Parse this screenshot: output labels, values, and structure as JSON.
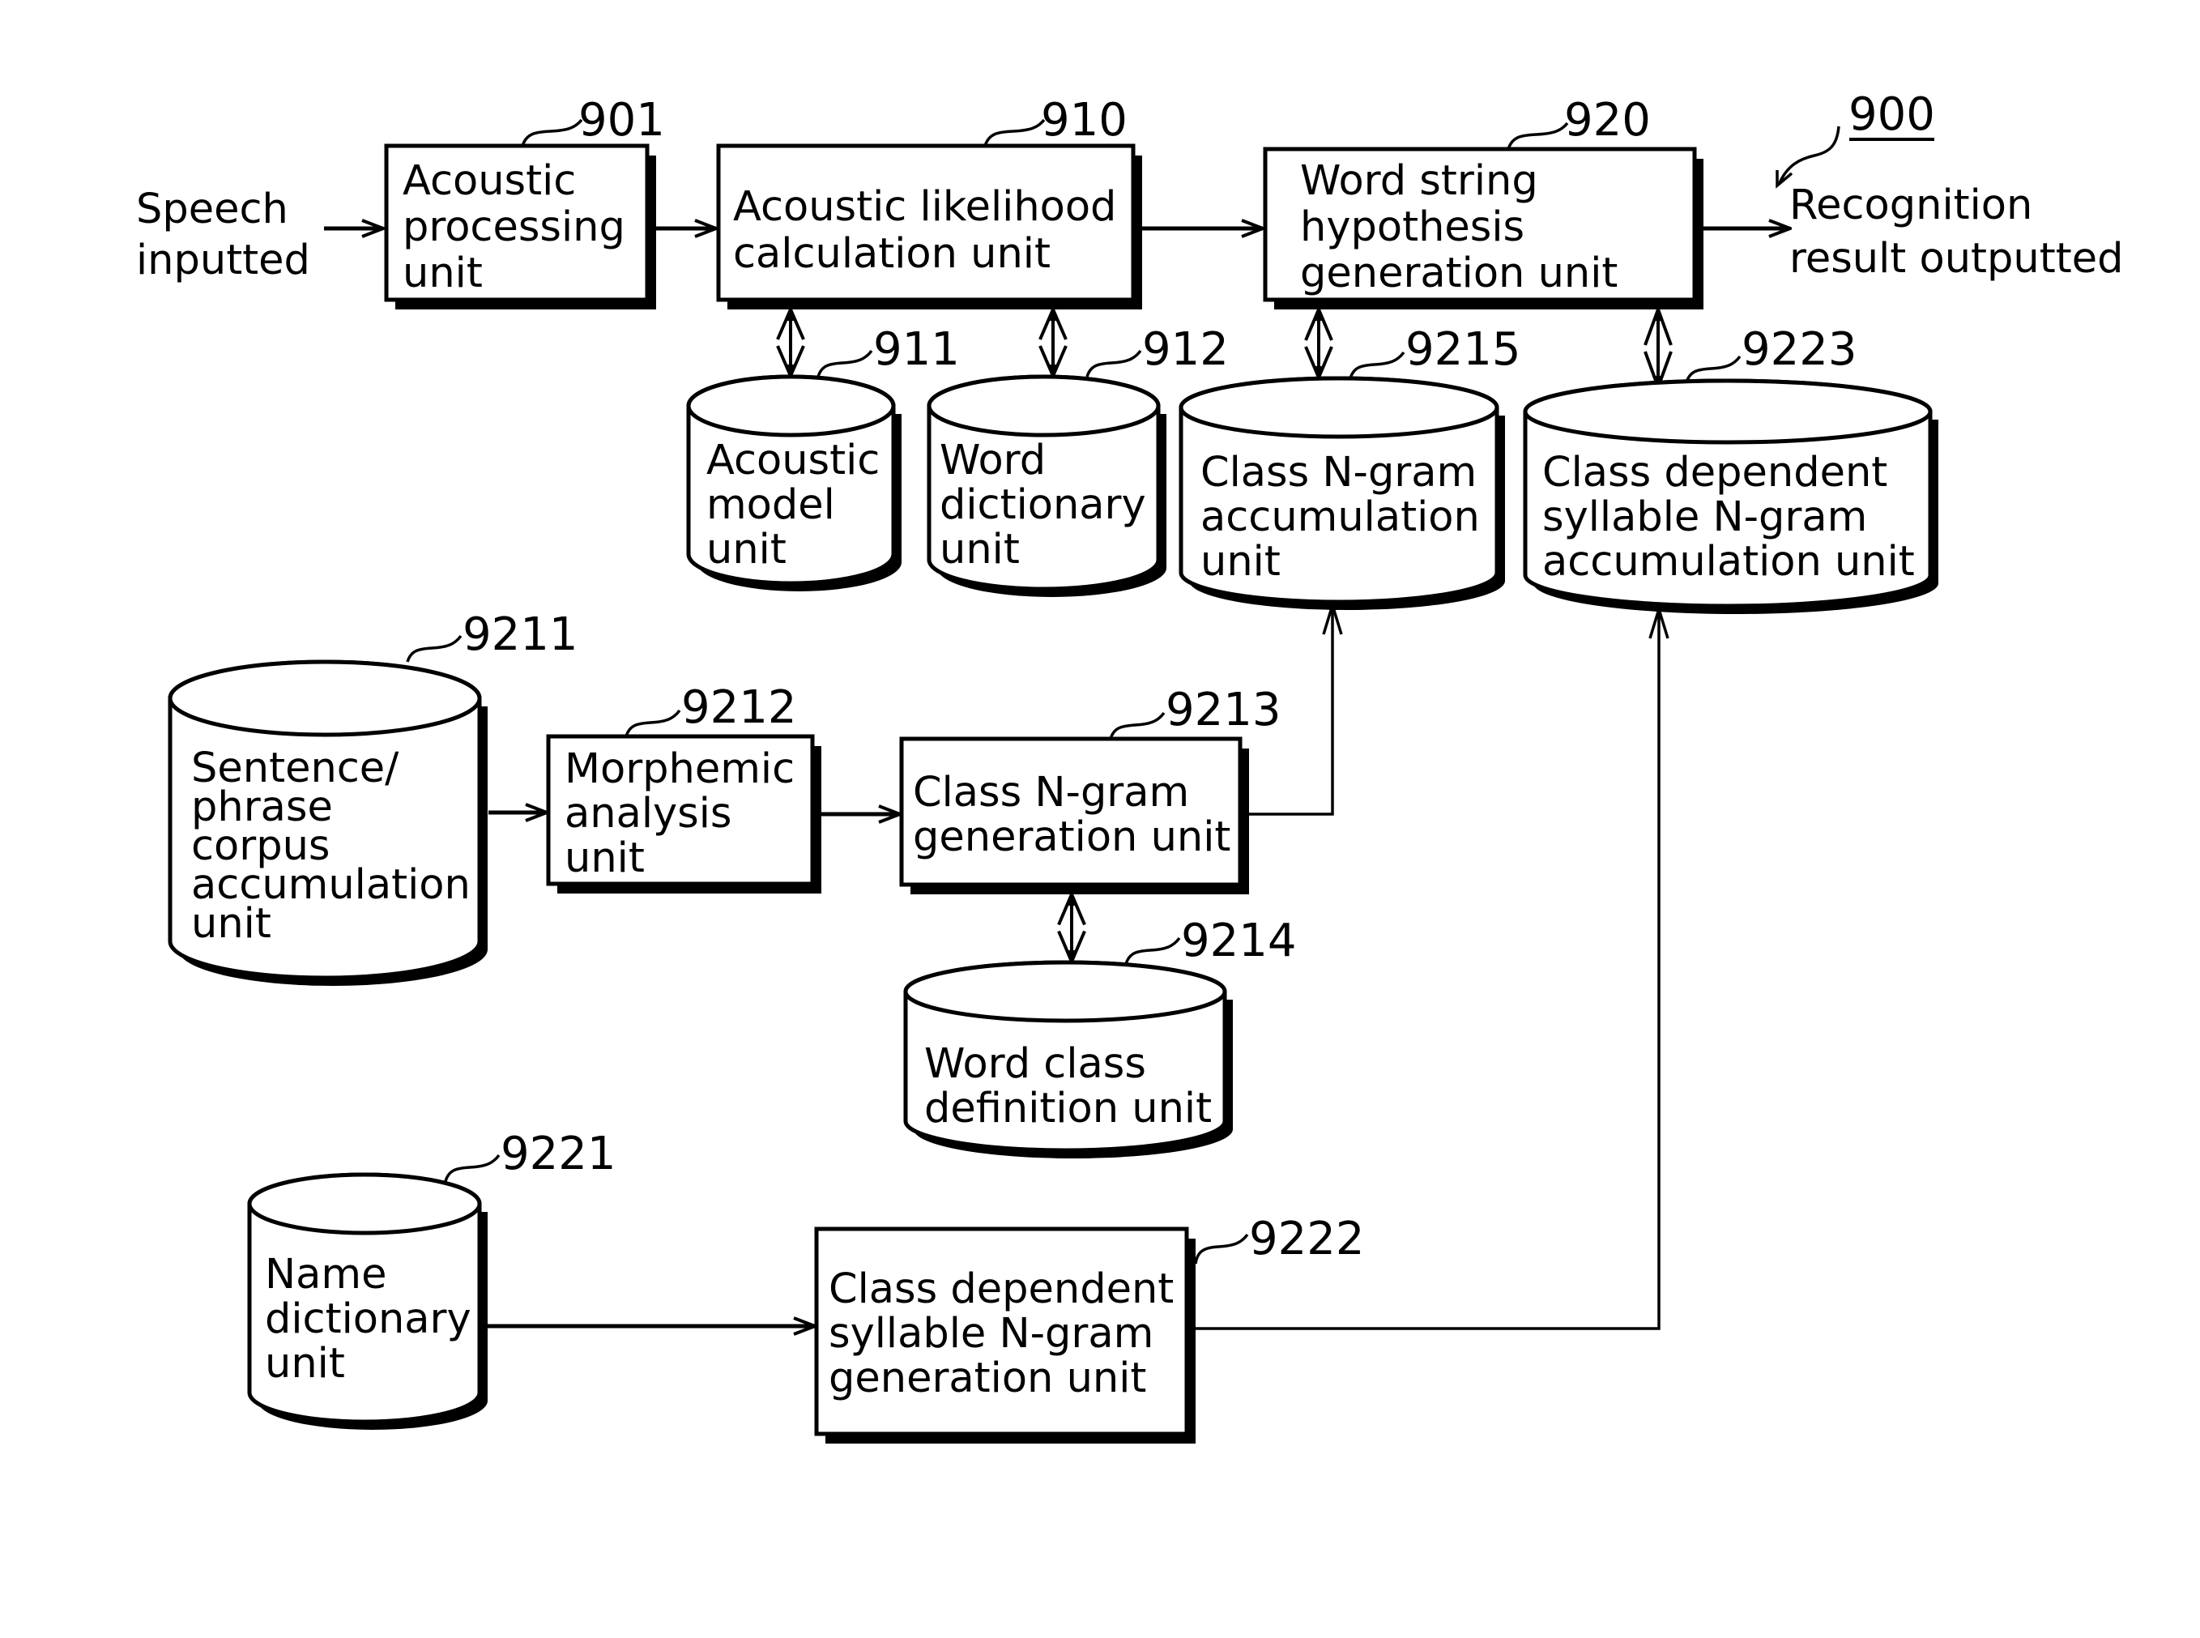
{
  "figure": {
    "reference": "900",
    "input_label": [
      "Speech",
      "inputted"
    ],
    "output_label": [
      "Recognition",
      "result outputted"
    ]
  },
  "boxes": {
    "acoustic_processing": {
      "ref": "901",
      "lines": [
        "Acoustic",
        "processing",
        "unit"
      ]
    },
    "acoustic_likelihood": {
      "ref": "910",
      "lines": [
        "Acoustic likelihood",
        "calculation unit"
      ]
    },
    "word_string_hypothesis": {
      "ref": "920",
      "lines": [
        "Word string",
        "hypothesis",
        "generation unit"
      ]
    },
    "morphemic_analysis": {
      "ref": "9212",
      "lines": [
        "Morphemic",
        "analysis",
        "unit"
      ]
    },
    "class_ngram_generation": {
      "ref": "9213",
      "lines": [
        "Class N-gram",
        "generation unit"
      ]
    },
    "class_dependent_syllable_generation": {
      "ref": "9222",
      "lines": [
        "Class dependent",
        "syllable N-gram",
        "generation unit"
      ]
    }
  },
  "databases": {
    "acoustic_model": {
      "ref": "911",
      "lines": [
        "Acoustic",
        "model",
        "unit"
      ]
    },
    "word_dictionary": {
      "ref": "912",
      "lines": [
        "Word",
        "dictionary",
        "unit"
      ]
    },
    "class_ngram_accumulation": {
      "ref": "9215",
      "lines": [
        "Class N-gram",
        "accumulation",
        "unit"
      ]
    },
    "class_dependent_syllable_accumulation": {
      "ref": "9223",
      "lines": [
        "Class dependent",
        "syllable N-gram",
        "accumulation unit"
      ]
    },
    "sentence_phrase_corpus": {
      "ref": "9211",
      "lines": [
        "Sentence/",
        "phrase",
        "corpus",
        "accumulation",
        "unit"
      ]
    },
    "word_class_definition": {
      "ref": "9214",
      "lines": [
        "Word class",
        "definition unit"
      ]
    },
    "name_dictionary": {
      "ref": "9221",
      "lines": [
        "Name",
        "dictionary",
        "unit"
      ]
    }
  },
  "connections": [
    {
      "from": "input",
      "to": "acoustic_processing",
      "type": "arrow"
    },
    {
      "from": "acoustic_processing",
      "to": "acoustic_likelihood",
      "type": "arrow"
    },
    {
      "from": "acoustic_likelihood",
      "to": "word_string_hypothesis",
      "type": "arrow"
    },
    {
      "from": "word_string_hypothesis",
      "to": "output",
      "type": "arrow"
    },
    {
      "from": "acoustic_likelihood",
      "to": "acoustic_model",
      "type": "bidirectional"
    },
    {
      "from": "acoustic_likelihood",
      "to": "word_dictionary",
      "type": "bidirectional"
    },
    {
      "from": "word_string_hypothesis",
      "to": "class_ngram_accumulation",
      "type": "bidirectional"
    },
    {
      "from": "word_string_hypothesis",
      "to": "class_dependent_syllable_accumulation",
      "type": "bidirectional"
    },
    {
      "from": "sentence_phrase_corpus",
      "to": "morphemic_analysis",
      "type": "arrow"
    },
    {
      "from": "morphemic_analysis",
      "to": "class_ngram_generation",
      "type": "arrow"
    },
    {
      "from": "class_ngram_generation",
      "to": "class_ngram_accumulation",
      "type": "arrow"
    },
    {
      "from": "class_ngram_generation",
      "to": "word_class_definition",
      "type": "bidirectional"
    },
    {
      "from": "name_dictionary",
      "to": "class_dependent_syllable_generation",
      "type": "arrow"
    },
    {
      "from": "class_dependent_syllable_generation",
      "to": "class_dependent_syllable_accumulation",
      "type": "arrow"
    }
  ]
}
